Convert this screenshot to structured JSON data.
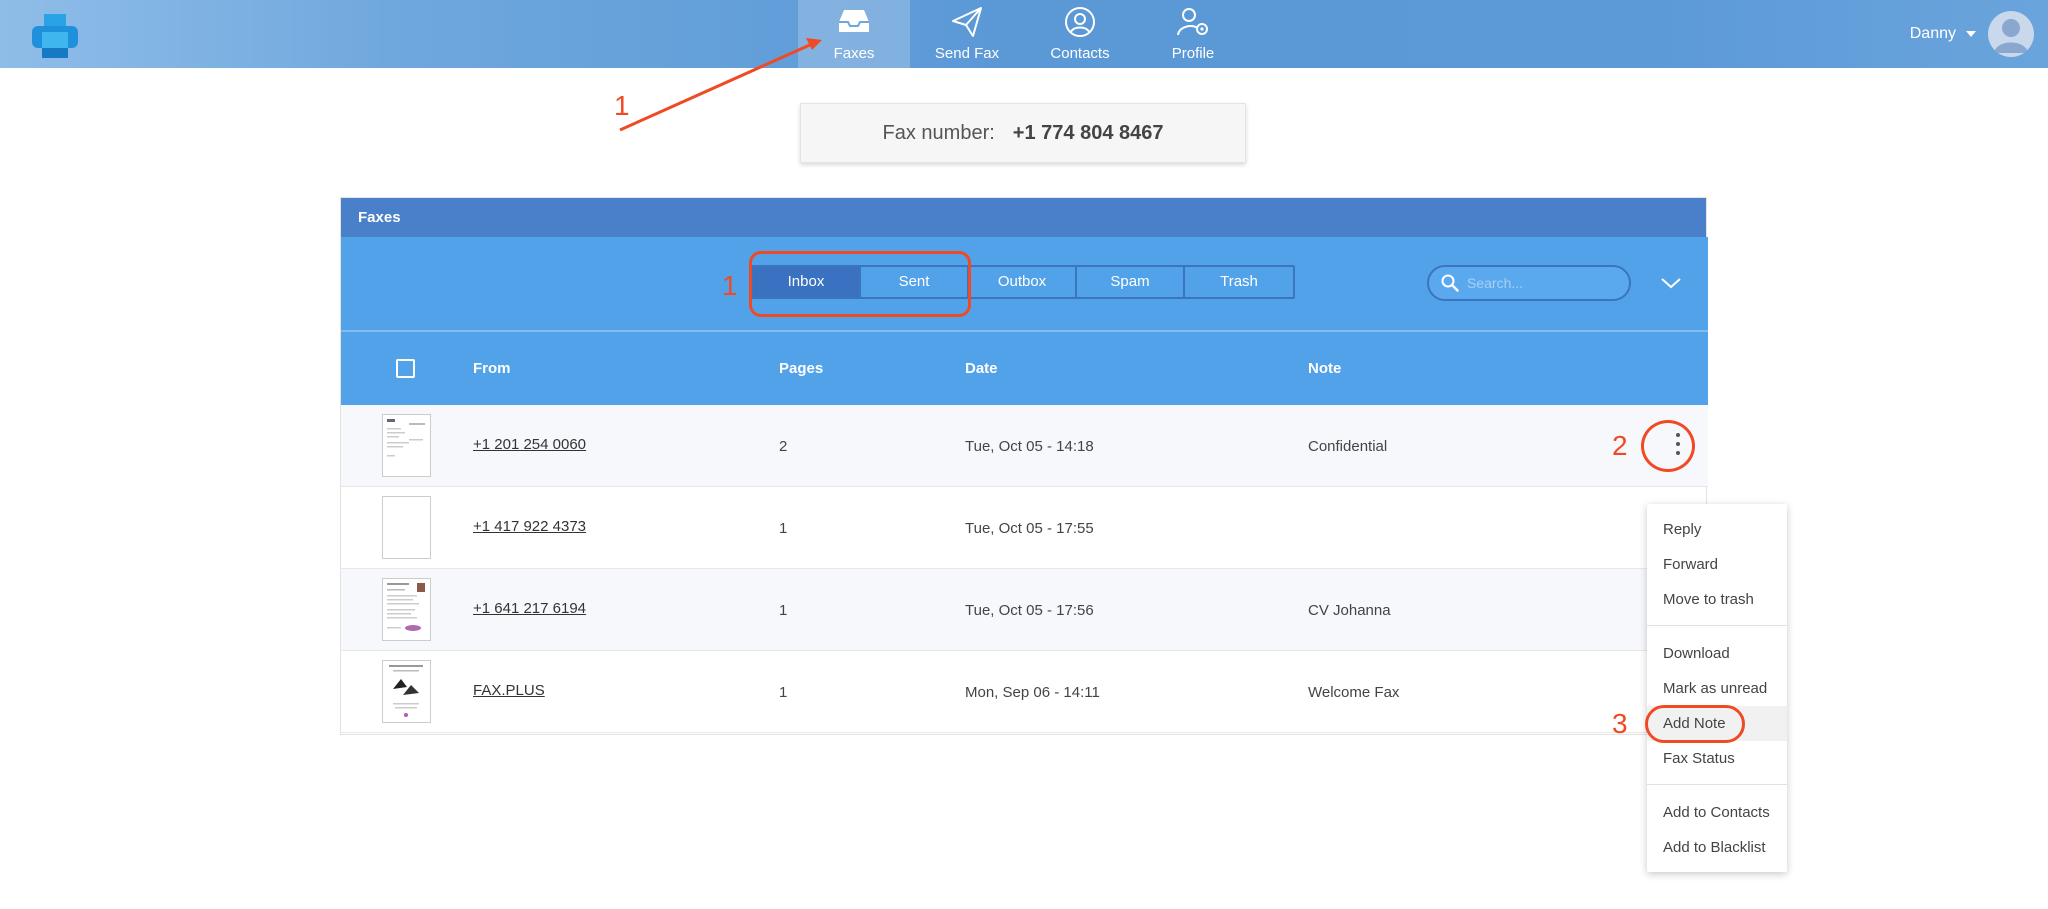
{
  "nav": {
    "items": [
      {
        "label": "Faxes",
        "icon": "inbox-icon",
        "active": true
      },
      {
        "label": "Send Fax",
        "icon": "paper-plane-icon"
      },
      {
        "label": "Contacts",
        "icon": "user-circle-icon"
      },
      {
        "label": "Profile",
        "icon": "user-gear-icon"
      }
    ],
    "user_name": "Danny"
  },
  "fax_number": {
    "label": "Fax number:",
    "value": "+1 774 804 8467"
  },
  "panel": {
    "title": "Faxes"
  },
  "tabs": [
    "Inbox",
    "Sent",
    "Outbox",
    "Spam",
    "Trash"
  ],
  "search": {
    "placeholder": "Search..."
  },
  "table": {
    "headers": {
      "from": "From",
      "pages": "Pages",
      "date": "Date",
      "note": "Note"
    },
    "rows": [
      {
        "from": "+1 201 254 0060",
        "pages": "2",
        "date": "Tue, Oct 05 - 14:18",
        "note": "Confidential"
      },
      {
        "from": "+1 417 922 4373",
        "pages": "1",
        "date": "Tue, Oct 05 - 17:55",
        "note": ""
      },
      {
        "from": "+1 641 217 6194",
        "pages": "1",
        "date": "Tue, Oct 05 - 17:56",
        "note": "CV Johanna"
      },
      {
        "from": "FAX.PLUS",
        "pages": "1",
        "date": "Mon, Sep 06 - 14:11",
        "note": "Welcome Fax"
      }
    ]
  },
  "context_menu": {
    "group1": [
      "Reply",
      "Forward",
      "Move to trash"
    ],
    "group2": [
      "Download",
      "Mark as unread",
      "Add Note",
      "Fax Status"
    ],
    "group3": [
      "Add to Contacts",
      "Add to Blacklist"
    ]
  },
  "annotations": {
    "step1_nav": "1",
    "step1_tabs": "1",
    "step2": "2",
    "step3": "3"
  },
  "colors": {
    "accent": "#52a2ea",
    "header": "#4a7fc9",
    "annotation": "#f04a24"
  }
}
